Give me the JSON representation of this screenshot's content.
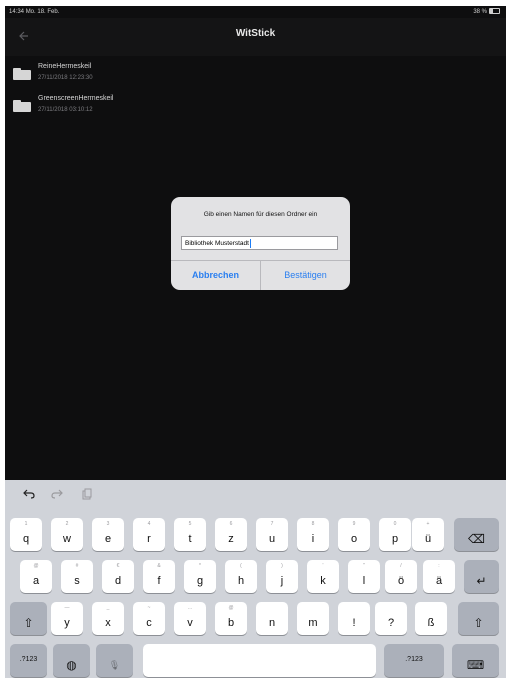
{
  "status_bar": {
    "time": "14:34",
    "date": "Mo. 18. Feb.",
    "battery": "38 %"
  },
  "nav": {
    "back_icon": "back-arrow-icon",
    "title": "WitStick"
  },
  "folders": [
    {
      "name": "ReineHermeskeil",
      "date": "27/11/2018 12:23:30"
    },
    {
      "name": "GreenscreenHermeskeil",
      "date": "27/11/2018 03:10:12"
    }
  ],
  "dialog": {
    "message": "Gib einen Namen für diesen Ordner ein",
    "input_value": "Bibliothek Musterstadt",
    "cancel_label": "Abbrechen",
    "confirm_label": "Bestätigen"
  },
  "keyboard": {
    "shortcut_icons": [
      "undo-icon",
      "redo-icon",
      "paste-icon"
    ],
    "row1": [
      {
        "main": "q",
        "sub": "1"
      },
      {
        "main": "w",
        "sub": "2"
      },
      {
        "main": "e",
        "sub": "3"
      },
      {
        "main": "r",
        "sub": "4"
      },
      {
        "main": "t",
        "sub": "5"
      },
      {
        "main": "z",
        "sub": "6"
      },
      {
        "main": "u",
        "sub": "7"
      },
      {
        "main": "i",
        "sub": "8"
      },
      {
        "main": "o",
        "sub": "9"
      },
      {
        "main": "p",
        "sub": "0"
      },
      {
        "main": "ü",
        "sub": "+"
      }
    ],
    "row2": [
      {
        "main": "a",
        "sub": "@"
      },
      {
        "main": "s",
        "sub": "#"
      },
      {
        "main": "d",
        "sub": "€"
      },
      {
        "main": "f",
        "sub": "&"
      },
      {
        "main": "g",
        "sub": "*"
      },
      {
        "main": "h",
        "sub": "("
      },
      {
        "main": "j",
        "sub": ")"
      },
      {
        "main": "k",
        "sub": "'"
      },
      {
        "main": "l",
        "sub": "\""
      },
      {
        "main": "ö",
        "sub": "/"
      },
      {
        "main": "ä",
        "sub": ":"
      }
    ],
    "row3": [
      {
        "main": "y",
        "sub": "—"
      },
      {
        "main": "x",
        "sub": "_"
      },
      {
        "main": "c",
        "sub": "~"
      },
      {
        "main": "v",
        "sub": "…"
      },
      {
        "main": "b",
        "sub": "@"
      },
      {
        "main": "n",
        "sub": ""
      },
      {
        "main": "m",
        "sub": ""
      },
      {
        "main": "!",
        "sub": ""
      },
      {
        "main": "?",
        "sub": ""
      },
      {
        "main": "ß",
        "sub": ""
      }
    ],
    "backspace_glyph": "⌫",
    "return_glyph": "↵",
    "shift_glyph": "⇧",
    "numbers_label": ".?123",
    "globe_glyph": "◍",
    "mic_glyph": "🎙",
    "hide_keyboard_glyph": "⌨"
  },
  "colors": {
    "accent": "#2a7ff0",
    "background": "#0e0e0f",
    "keyboard": "#d0d3d9"
  }
}
